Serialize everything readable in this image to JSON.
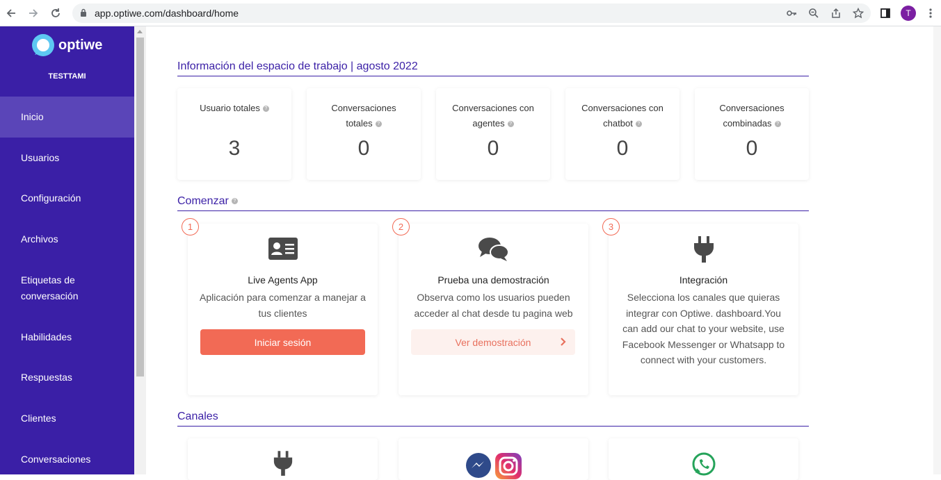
{
  "browser": {
    "url": "app.optiwe.com/dashboard/home",
    "avatar_letter": "T"
  },
  "sidebar": {
    "logo_text": "optiwe",
    "workspace": "TESTTAMI",
    "items": [
      {
        "label": "Inicio",
        "active": true
      },
      {
        "label": "Usuarios"
      },
      {
        "label": "Configuración"
      },
      {
        "label": "Archivos"
      },
      {
        "label": "Etiquetas de conversación"
      },
      {
        "label": "Habilidades"
      },
      {
        "label": "Respuestas"
      },
      {
        "label": "Clientes"
      },
      {
        "label": "Conversaciones"
      }
    ]
  },
  "workspace_info": {
    "title": "Información del espacio de trabajo | agosto 2022",
    "stats": [
      {
        "label": "Usuario totales",
        "value": "3"
      },
      {
        "label": "Conversaciones totales",
        "value": "0"
      },
      {
        "label": "Conversaciones con agentes",
        "value": "0"
      },
      {
        "label": "Conversaciones con chatbot",
        "value": "0"
      },
      {
        "label": "Conversaciones combinadas",
        "value": "0"
      }
    ]
  },
  "get_started": {
    "title": "Comenzar",
    "steps": [
      {
        "number": "1",
        "icon": "id-card-icon",
        "title": "Live Agents App",
        "description": "Aplicación para comenzar a manejar a tus clientes",
        "button": "Iniciar sesión"
      },
      {
        "number": "2",
        "icon": "chat-bubbles-icon",
        "title": "Prueba una demostración",
        "description": "Observa como los usuarios pueden acceder al chat desde tu pagina web",
        "button": "Ver demostración"
      },
      {
        "number": "3",
        "icon": "plug-icon",
        "title": "Integración",
        "description": "Selecciona los canales que quieras integrar con Optiwe. dashboard.You can add our chat to your website, use Facebook Messenger or Whatsapp to connect with your customers."
      }
    ]
  },
  "channels": {
    "title": "Canales",
    "cards": [
      {
        "icon": "plug-icon"
      },
      {
        "icon": "messenger-instagram-icon"
      },
      {
        "icon": "whatsapp-icon"
      }
    ]
  },
  "colors": {
    "sidebar": "#3a1fa6",
    "sidebar_active": "#5a45b8",
    "accent": "#f26a55",
    "section_title": "#3a1fa6"
  }
}
